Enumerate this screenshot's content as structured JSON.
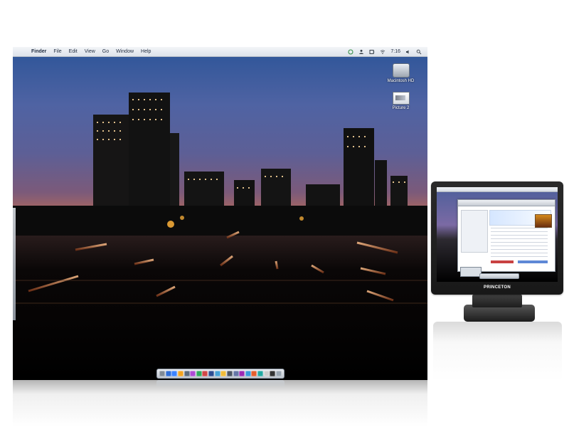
{
  "menubar": {
    "apple_icon": "apple-icon",
    "items": [
      "Finder",
      "File",
      "Edit",
      "View",
      "Go",
      "Window",
      "Help"
    ],
    "status": {
      "clock": "7:16",
      "icons": [
        "sync-icon",
        "user-icon",
        "battery-icon",
        "wifi-icon",
        "sound-icon",
        "spotlight-icon"
      ]
    }
  },
  "desktop": {
    "icons": [
      {
        "label": "Macintosh HD",
        "icon": "disk-icon"
      },
      {
        "label": "Picture 2",
        "icon": "picture-icon"
      }
    ],
    "wallpaper": "city skyline at dusk"
  },
  "dock": {
    "item_count": 20,
    "colors": [
      "#7f8a96",
      "#2f6ed6",
      "#3b82ff",
      "#f3a420",
      "#5c6c7d",
      "#ad4ad5",
      "#2fa85f",
      "#d04848",
      "#2d4d91",
      "#47a3d6",
      "#f0bc3a",
      "#4b5563",
      "#6576a6",
      "#9b2bb3",
      "#3a9ad9",
      "#e45f2f",
      "#22a8a1",
      "#cccccc",
      "#343434",
      "#9aa6b2"
    ]
  },
  "monitor": {
    "brand": "PRINCETON"
  }
}
